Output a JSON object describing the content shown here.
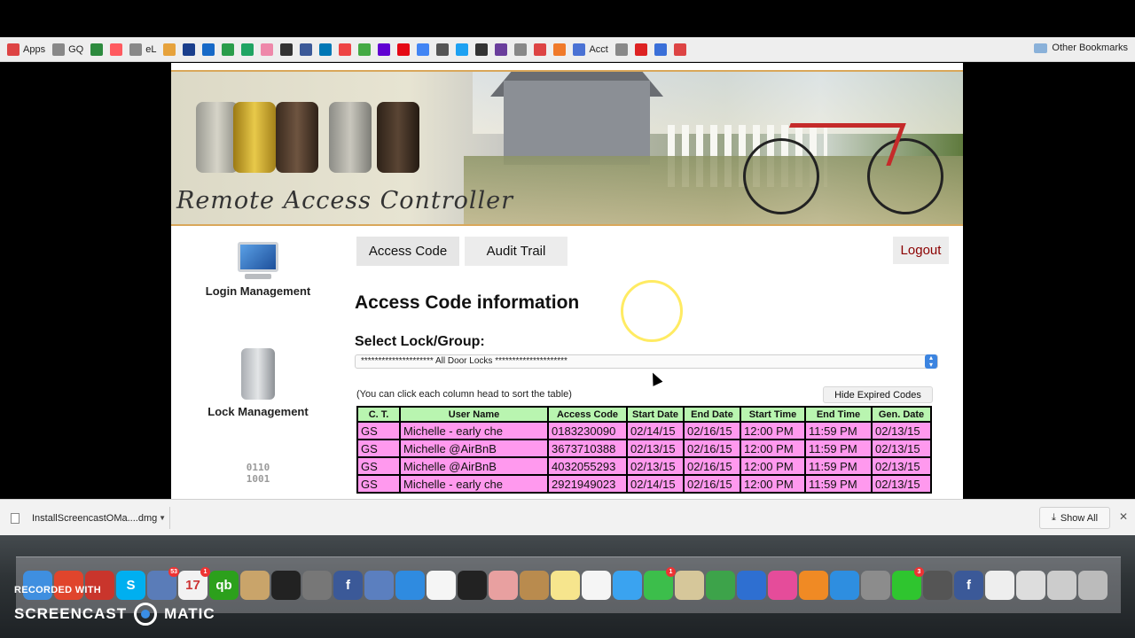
{
  "bookmarks": [
    {
      "label": "Apps",
      "icon": "apps-grid-icon",
      "color": "#d44"
    },
    {
      "label": "GQ",
      "icon": "page-icon",
      "color": "#888"
    },
    {
      "label": "",
      "icon": "v-icon",
      "color": "#2d8a3e"
    },
    {
      "label": "",
      "icon": "airbnb-icon",
      "color": "#ff5a5f"
    },
    {
      "label": "eL",
      "icon": "page-icon",
      "color": "#888"
    },
    {
      "label": "",
      "icon": "photo-icon",
      "color": "#e6a23c"
    },
    {
      "label": "",
      "icon": "paypal-icon",
      "color": "#1a3e8c"
    },
    {
      "label": "",
      "icon": "p-icon",
      "color": "#1769c7"
    },
    {
      "label": "",
      "icon": "drive-icon",
      "color": "#2a9d4b"
    },
    {
      "label": "",
      "icon": "hangouts-icon",
      "color": "#1fa463"
    },
    {
      "label": "",
      "icon": "pinwheel-icon",
      "color": "#e8a"
    },
    {
      "label": "",
      "icon": "w-icon",
      "color": "#333"
    },
    {
      "label": "",
      "icon": "facebook-icon",
      "color": "#3b5998"
    },
    {
      "label": "",
      "icon": "linkedin-icon",
      "color": "#0077b5"
    },
    {
      "label": "",
      "icon": "target-icon",
      "color": "#e44"
    },
    {
      "label": "",
      "icon": "map-icon",
      "color": "#4a4"
    },
    {
      "label": "",
      "icon": "yahoo-icon",
      "color": "#6001d2"
    },
    {
      "label": "",
      "icon": "netflix-icon",
      "color": "#e50914"
    },
    {
      "label": "",
      "icon": "translate-icon",
      "color": "#4285f4"
    },
    {
      "label": "",
      "icon": "wikipedia-icon",
      "color": "#555"
    },
    {
      "label": "",
      "icon": "twitter-icon",
      "color": "#1da1f2"
    },
    {
      "label": "",
      "icon": "tnp-icon",
      "color": "#333"
    },
    {
      "label": "",
      "icon": "peace-icon",
      "color": "#6a3e9c"
    },
    {
      "label": "",
      "icon": "settings-icon",
      "color": "#888"
    },
    {
      "label": "",
      "icon": "gmail-icon",
      "color": "#d44"
    },
    {
      "label": "",
      "icon": "orange-circle-icon",
      "color": "#f07a2a"
    },
    {
      "label": "Acct",
      "icon": "docs-icon",
      "color": "#4a72d4"
    },
    {
      "label": "",
      "icon": "page-icon",
      "color": "#888"
    },
    {
      "label": "",
      "icon": "stop-icon",
      "color": "#d22"
    },
    {
      "label": "",
      "icon": "q-icon",
      "color": "#3a6fd8"
    },
    {
      "label": "",
      "icon": "pen-icon",
      "color": "#d44"
    }
  ],
  "other_bookmarks": "Other Bookmarks",
  "banner_title": "Remote Access Controller",
  "sidebar": [
    {
      "label": "Login Management"
    },
    {
      "label": "Lock Management"
    },
    {
      "label": "",
      "icon_text": "0110 1001"
    }
  ],
  "tabs": {
    "access_code": "Access Code",
    "audit_trail": "Audit Trail"
  },
  "logout": "Logout",
  "heading": "Access Code information",
  "select_label": "Select Lock/Group:",
  "select_value": "********************* All Door Locks *********************",
  "hint": "(You can click each column head to sort the table)",
  "hide_expired": "Hide Expired Codes",
  "table": {
    "headers": [
      "C. T.",
      "User Name",
      "Access Code",
      "Start Date",
      "End Date",
      "Start Time",
      "End Time",
      "Gen. Date"
    ],
    "rows": [
      [
        "GS",
        "Michelle - early che",
        "0183230090",
        "02/14/15",
        "02/16/15",
        "12:00 PM",
        "11:59 PM",
        "02/13/15"
      ],
      [
        "GS",
        "Michelle @AirBnB",
        "3673710388",
        "02/13/15",
        "02/16/15",
        "12:00 PM",
        "11:59 PM",
        "02/13/15"
      ],
      [
        "GS",
        "Michelle @AirBnB",
        "4032055293",
        "02/13/15",
        "02/16/15",
        "12:00 PM",
        "11:59 PM",
        "02/13/15"
      ],
      [
        "GS",
        "Michelle - early che",
        "2921949023",
        "02/14/15",
        "02/16/15",
        "12:00 PM",
        "11:59 PM",
        "02/13/15"
      ]
    ]
  },
  "download": {
    "filename": "InstallScreencastOMa....dmg",
    "show_all": "Show All"
  },
  "dock": [
    {
      "icon": "finder-icon",
      "color": "#3f8fe0"
    },
    {
      "icon": "chrome-icon",
      "color": "#e0452c"
    },
    {
      "icon": "mail-icon",
      "color": "#c9352c"
    },
    {
      "icon": "skype-icon",
      "color": "#00aff0",
      "glyph": "S"
    },
    {
      "icon": "preview-icon",
      "color": "#5a7cb8",
      "badge": "53"
    },
    {
      "icon": "calendar-icon",
      "color": "#f2f2f2",
      "glyph": "17",
      "badge": "1"
    },
    {
      "icon": "quickbooks-icon",
      "color": "#2ca01c",
      "glyph": "qb"
    },
    {
      "icon": "contacts-icon",
      "color": "#c9a46a"
    },
    {
      "icon": "drive-icon",
      "color": "#222"
    },
    {
      "icon": "launchpad-icon",
      "color": "#777"
    },
    {
      "icon": "facebook-icon",
      "color": "#3b5998",
      "glyph": "f"
    },
    {
      "icon": "messenger-icon",
      "color": "#5b7fbf"
    },
    {
      "icon": "safari-icon",
      "color": "#2f8be0"
    },
    {
      "icon": "grid-icon",
      "color": "#f5f5f5"
    },
    {
      "icon": "quicktime-icon",
      "color": "#222"
    },
    {
      "icon": "photos-icon",
      "color": "#e8a0a0"
    },
    {
      "icon": "notebook-icon",
      "color": "#b98b4e"
    },
    {
      "icon": "notes-icon",
      "color": "#f6e58d"
    },
    {
      "icon": "reminders-icon",
      "color": "#f5f5f5"
    },
    {
      "icon": "messages-icon",
      "color": "#3aa3f0"
    },
    {
      "icon": "facetime-icon",
      "color": "#3cbe4b",
      "badge": "1"
    },
    {
      "icon": "textedit-icon",
      "color": "#d6c79a"
    },
    {
      "icon": "numbers-icon",
      "color": "#3da34a"
    },
    {
      "icon": "keynote-icon",
      "color": "#2e6fd1"
    },
    {
      "icon": "itunes-icon",
      "color": "#e54c9a"
    },
    {
      "icon": "ibooks-icon",
      "color": "#f08a24"
    },
    {
      "icon": "appstore-icon",
      "color": "#2e8ee0"
    },
    {
      "icon": "system-prefs-icon",
      "color": "#8c8c8c"
    },
    {
      "icon": "line-icon",
      "color": "#2fc52f",
      "badge": "3"
    },
    {
      "icon": "screenshot-icon",
      "color": "#555"
    },
    {
      "icon": "facebook-icon",
      "color": "#3b5998",
      "glyph": "f"
    },
    {
      "icon": "document-icon",
      "color": "#eee"
    },
    {
      "icon": "drive-disk-icon",
      "color": "#ddd"
    },
    {
      "icon": "folder-icon",
      "color": "#ccc"
    },
    {
      "icon": "trash-icon",
      "color": "#bbb"
    }
  ],
  "watermark": {
    "top": "RECORDED WITH",
    "left": "SCREENCAST",
    "right": "MATIC"
  }
}
